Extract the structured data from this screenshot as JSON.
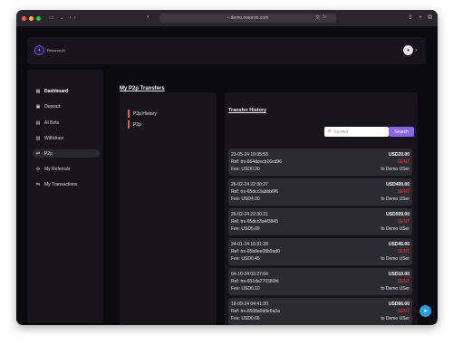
{
  "browser": {
    "url": "demo.resoron.com",
    "colors": {
      "close": "#ff5f57",
      "minimize": "#febc2e",
      "maximize": "#28c840"
    }
  },
  "header": {
    "logo_text": "Resoron AI"
  },
  "sidebar": {
    "items": [
      {
        "label": "Dashboard",
        "icon": "grid-icon"
      },
      {
        "label": "Deposit",
        "icon": "deposit-icon"
      },
      {
        "label": "AI Bots",
        "icon": "bot-icon"
      },
      {
        "label": "Withdraw",
        "icon": "withdraw-icon"
      },
      {
        "label": "P2p",
        "icon": "swap-icon"
      },
      {
        "label": "My Referrals",
        "icon": "referrals-icon"
      },
      {
        "label": "My Transactions",
        "icon": "transactions-icon"
      }
    ]
  },
  "main": {
    "title": "My P2p Transfers"
  },
  "p2p_menu": {
    "items": [
      "P2p History",
      "P2p"
    ]
  },
  "history": {
    "title": "Transfer History",
    "search": {
      "placeholder": "Txn Ref",
      "button_label": "Search"
    },
    "transactions": [
      {
        "date": "23-05-24 10:35:53",
        "amount": "USD20.00",
        "ref": "Ref: trx-664dcecb16cd96",
        "status": "SENT",
        "fee": "Fee: USD0.20",
        "to": "to Demo USer"
      },
      {
        "date": "26-02-24 22:30:27",
        "amount": "USD400.00",
        "ref": "Ref: trx-65dcc3abbb6f6",
        "status": "SENT",
        "fee": "Fee: USD4.00",
        "to": "to Demo USer"
      },
      {
        "date": "26-02-24 22:30:21",
        "amount": "USD509.00",
        "ref": "Ref: trx-65dcc3a4f3845",
        "status": "SENT",
        "fee": "Fee: USD5.09",
        "to": "to Demo USer"
      },
      {
        "date": "24-01-24 16:31:28",
        "amount": "USD45.00",
        "ref": "Ref: trx-65b0ee08b9ad0",
        "status": "SENT",
        "fee": "Fee: USD0.45",
        "to": "to Demo USer"
      },
      {
        "date": "04-10-24 03:27:04",
        "amount": "USD10.00",
        "ref": "Ref: trx-651da770380fd",
        "status": "SENT",
        "fee": "Fee: USD0.10",
        "to": "to Demo USer"
      },
      {
        "date": "18-09-24 04:41:20",
        "amount": "USD66.00",
        "ref": "Ref: trx-6508a0dde6a3a",
        "status": "SENT",
        "fee": "Fee: USD0.66",
        "to": "to Demo USer"
      }
    ]
  },
  "colors": {
    "accent": "#8a63f0",
    "menu_marker": "#e2642a",
    "sent": "#e0433f"
  }
}
